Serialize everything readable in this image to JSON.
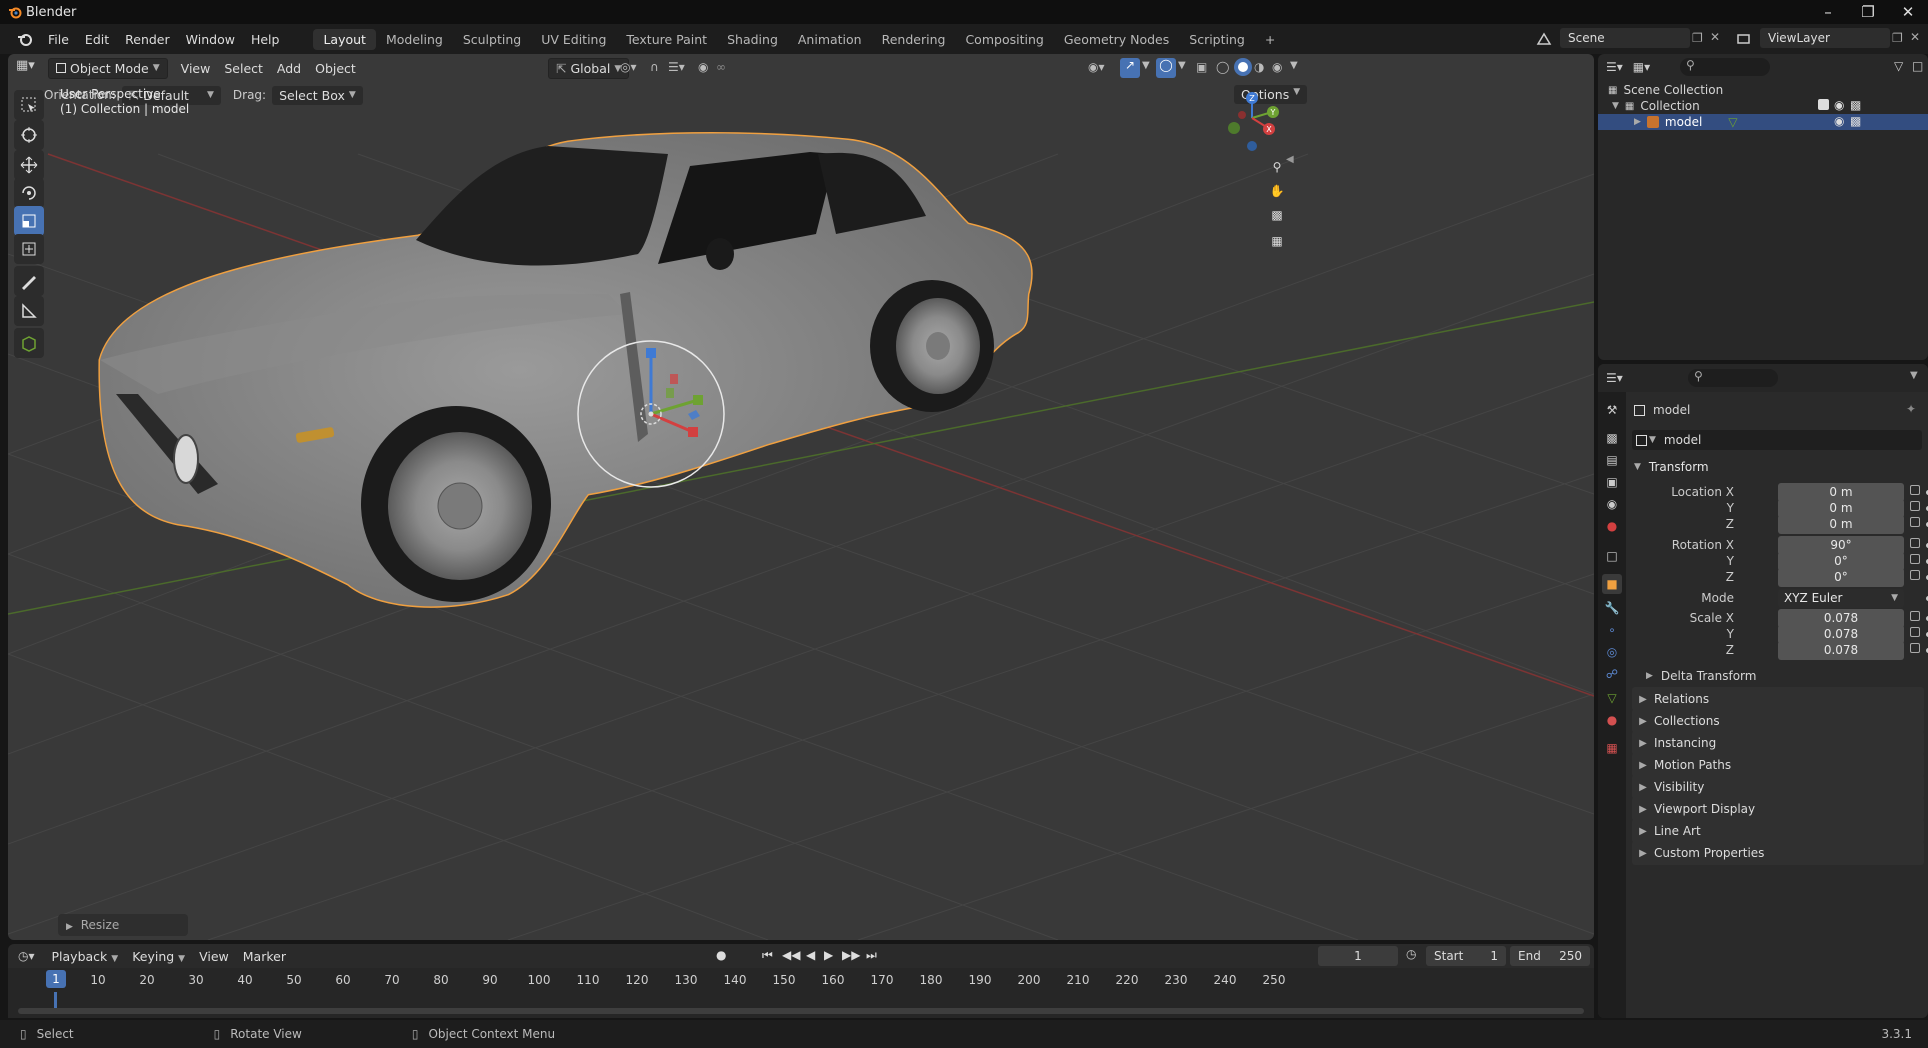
{
  "app": {
    "title": "Blender",
    "version": "3.3.1"
  },
  "menu": [
    "File",
    "Edit",
    "Render",
    "Window",
    "Help"
  ],
  "workspaces": [
    {
      "label": "Layout",
      "active": true
    },
    {
      "label": "Modeling",
      "active": false
    },
    {
      "label": "Sculpting",
      "active": false
    },
    {
      "label": "UV Editing",
      "active": false
    },
    {
      "label": "Texture Paint",
      "active": false
    },
    {
      "label": "Shading",
      "active": false
    },
    {
      "label": "Animation",
      "active": false
    },
    {
      "label": "Rendering",
      "active": false
    },
    {
      "label": "Compositing",
      "active": false
    },
    {
      "label": "Geometry Nodes",
      "active": false
    },
    {
      "label": "Scripting",
      "active": false
    }
  ],
  "add_workspace": "+",
  "scene": {
    "name": "Scene",
    "view_layer": "ViewLayer"
  },
  "viewport": {
    "mode": "Object Mode",
    "menus": [
      "View",
      "Select",
      "Add",
      "Object"
    ],
    "transform_orientation": "Global",
    "orientation_label": "Orientation:",
    "orientation_value": "Default",
    "drag_label": "Drag:",
    "drag_value": "Select Box",
    "options_label": "Options",
    "overlay_title": "User Perspective",
    "overlay_sub": "(1) Collection | model",
    "last_op": "Resize",
    "gizmo_axes": {
      "x": "X",
      "y": "Y",
      "z": "Z"
    }
  },
  "outliner": {
    "root": "Scene Collection",
    "collection": "Collection",
    "object": "model"
  },
  "properties": {
    "object_name": "model",
    "datablock_name": "model",
    "transform_header": "Transform",
    "location": {
      "label_x": "Location X",
      "label_y": "Y",
      "label_z": "Z",
      "x": "0 m",
      "y": "0 m",
      "z": "0 m"
    },
    "rotation": {
      "label_x": "Rotation X",
      "label_y": "Y",
      "label_z": "Z",
      "x": "90°",
      "y": "0°",
      "z": "0°"
    },
    "mode_label": "Mode",
    "mode_value": "XYZ Euler",
    "scale": {
      "label_x": "Scale X",
      "label_y": "Y",
      "label_z": "Z",
      "x": "0.078",
      "y": "0.078",
      "z": "0.078"
    },
    "delta_transform": "Delta Transform",
    "panels": [
      "Relations",
      "Collections",
      "Instancing",
      "Motion Paths",
      "Visibility",
      "Viewport Display",
      "Line Art",
      "Custom Properties"
    ]
  },
  "timeline": {
    "menus": [
      "Playback",
      "Keying",
      "View",
      "Marker"
    ],
    "current_frame": "1",
    "start_label": "Start",
    "start": "1",
    "end_label": "End",
    "end": "250",
    "ruler": [
      "10",
      "20",
      "30",
      "40",
      "50",
      "60",
      "70",
      "80",
      "90",
      "100",
      "110",
      "120",
      "130",
      "140",
      "150",
      "160",
      "170",
      "180",
      "190",
      "200",
      "210",
      "220",
      "230",
      "240",
      "250"
    ],
    "playhead": "1"
  },
  "status": {
    "select": "Select",
    "rotate": "Rotate View",
    "context": "Object Context Menu"
  },
  "colors": {
    "accent": "#4772b3",
    "selection": "#f0a040",
    "x_axis": "#d34040",
    "y_axis": "#6ea232",
    "z_axis": "#3f7ad4"
  }
}
